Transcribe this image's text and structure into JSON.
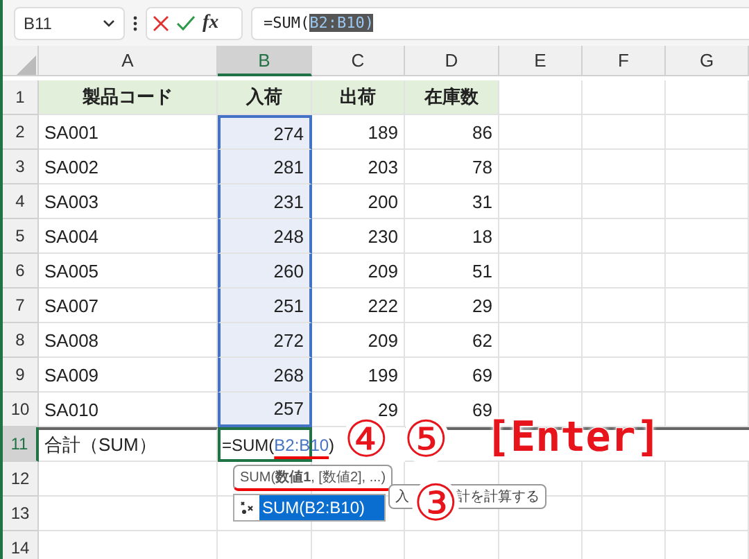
{
  "formula_bar": {
    "name_box": "B11",
    "function_button": "fx",
    "formula": "=SUM(",
    "formula_selected": "B2:B10)"
  },
  "columns": [
    {
      "label": "A",
      "selected": false
    },
    {
      "label": "B",
      "selected": true
    },
    {
      "label": "C",
      "selected": false
    },
    {
      "label": "D",
      "selected": false
    },
    {
      "label": "E",
      "selected": false
    },
    {
      "label": "F",
      "selected": false
    },
    {
      "label": "G",
      "selected": false
    }
  ],
  "rows": [
    {
      "header": "1",
      "selected": false,
      "kind": "heading",
      "cells": [
        "製品コード",
        "入荷",
        "出荷",
        "在庫数"
      ]
    },
    {
      "header": "2",
      "selected": false,
      "kind": "data",
      "range_selected": true,
      "cells": [
        "SA001",
        "274",
        "189",
        "86"
      ]
    },
    {
      "header": "3",
      "selected": false,
      "kind": "data",
      "range_selected": true,
      "cells": [
        "SA002",
        "281",
        "203",
        "78"
      ]
    },
    {
      "header": "4",
      "selected": false,
      "kind": "data",
      "range_selected": true,
      "cells": [
        "SA003",
        "231",
        "200",
        "31"
      ]
    },
    {
      "header": "5",
      "selected": false,
      "kind": "data",
      "range_selected": true,
      "cells": [
        "SA004",
        "248",
        "230",
        "18"
      ]
    },
    {
      "header": "6",
      "selected": false,
      "kind": "data",
      "range_selected": true,
      "cells": [
        "SA005",
        "260",
        "209",
        "51"
      ]
    },
    {
      "header": "7",
      "selected": false,
      "kind": "data",
      "range_selected": true,
      "cells": [
        "SA007",
        "251",
        "222",
        "29"
      ]
    },
    {
      "header": "8",
      "selected": false,
      "kind": "data",
      "range_selected": true,
      "cells": [
        "SA008",
        "272",
        "209",
        "62"
      ]
    },
    {
      "header": "9",
      "selected": false,
      "kind": "data",
      "range_selected": true,
      "cells": [
        "SA009",
        "268",
        "199",
        "69"
      ]
    },
    {
      "header": "10",
      "selected": false,
      "kind": "data",
      "range_selected": true,
      "cells": [
        "SA010",
        "257",
        "29",
        "69"
      ]
    },
    {
      "header": "11",
      "selected": true,
      "kind": "total",
      "cells": [
        "合計（SUM）"
      ],
      "editing": {
        "prefix": "=SUM(",
        "reference": "B2:B10",
        "suffix": ")"
      }
    },
    {
      "header": "12",
      "selected": false,
      "kind": "empty",
      "cells": []
    },
    {
      "header": "13",
      "selected": false,
      "kind": "empty",
      "cells": []
    },
    {
      "header": "14",
      "selected": false,
      "kind": "empty",
      "cells": []
    }
  ],
  "autocomplete": {
    "tooltip": "SUM(**数値1**, [数値2], ...)",
    "items": [
      {
        "label": "SUM(B2:B10)",
        "selected": true
      }
    ],
    "description_parts": [
      "入",
      "計を計算する"
    ]
  },
  "annotations": [
    {
      "kind": "circled",
      "text": "④"
    },
    {
      "kind": "circled",
      "text": "⑤"
    },
    {
      "kind": "key",
      "text": "[Enter]"
    },
    {
      "kind": "circled",
      "text": "③"
    }
  ]
}
